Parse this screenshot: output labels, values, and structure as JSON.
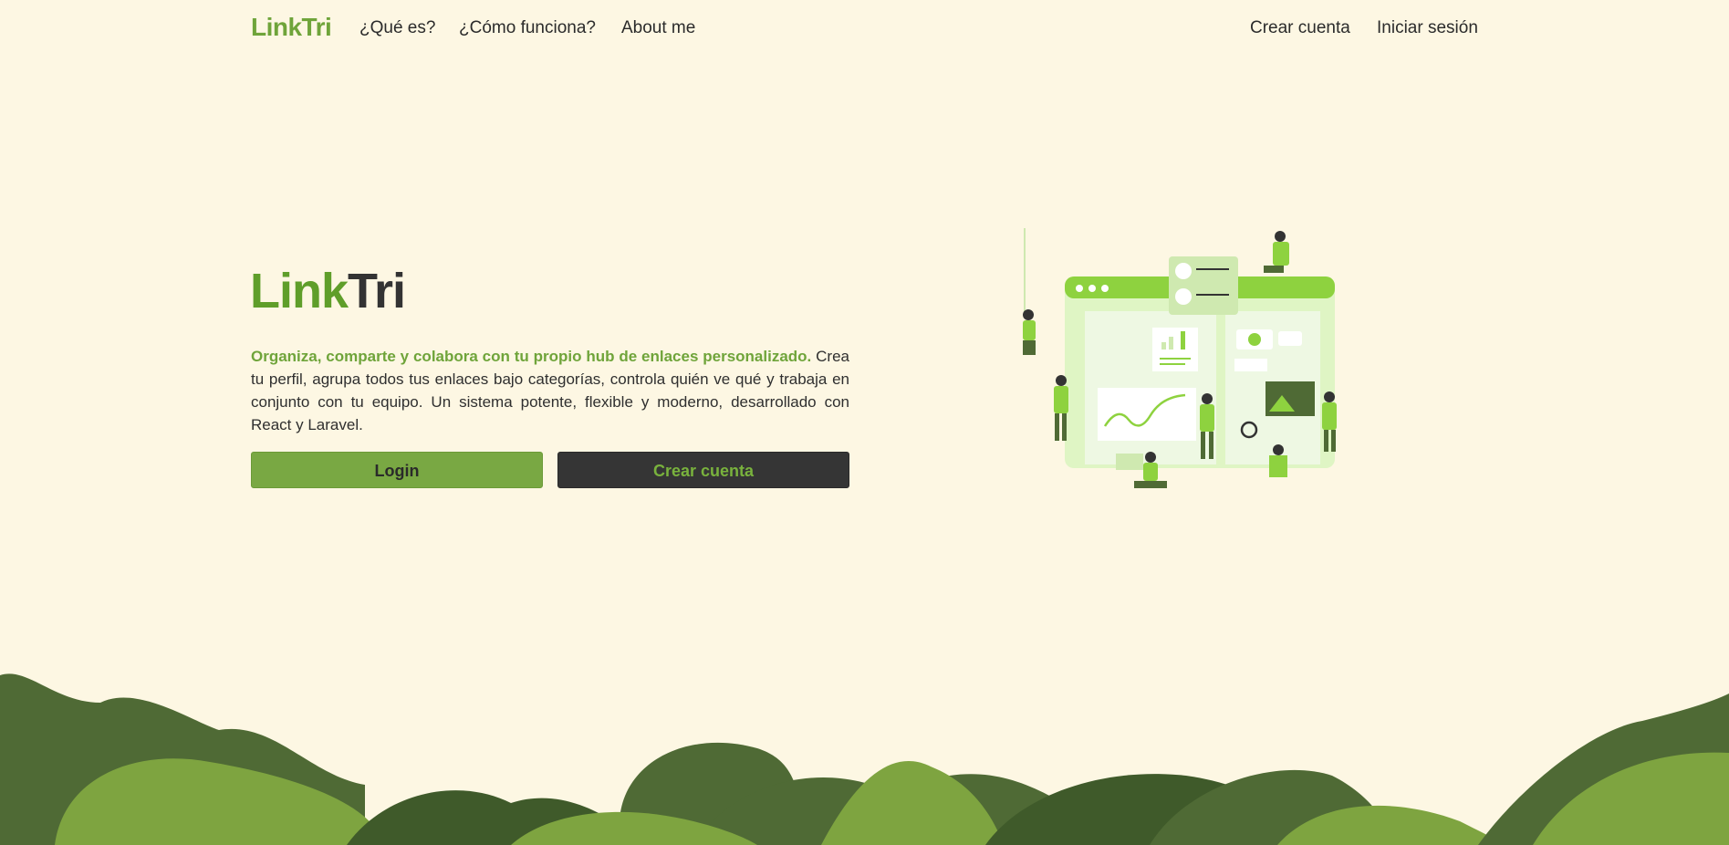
{
  "nav": {
    "brand": "LinkTri",
    "links": [
      "¿Qué es?",
      "¿Cómo funciona?",
      "About me"
    ],
    "auth": {
      "register": "Crear cuenta",
      "login": "Iniciar sesión"
    }
  },
  "hero": {
    "title_part1": "Link",
    "title_part2": "Tri",
    "highlight": "Organiza, comparte y colabora con tu propio hub de enlaces personalizado.",
    "description": "Crea tu perfil, agrupa todos tus enlaces bajo categorías, controla quién ve qué y trabaja en conjunto con tu equipo. Un sistema potente, flexible y moderno, desarrollado con React y Laravel.",
    "buttons": {
      "login": "Login",
      "register": "Crear cuenta"
    }
  },
  "illustration": {
    "icon": "team-collaboration-illustration"
  },
  "colors": {
    "background": "#fdf7e3",
    "brand_green": "#6fa43a",
    "button_green": "#79a843",
    "button_dark": "#353535",
    "hill_dark": "#4f6a35",
    "hill_light": "#7ea440"
  }
}
